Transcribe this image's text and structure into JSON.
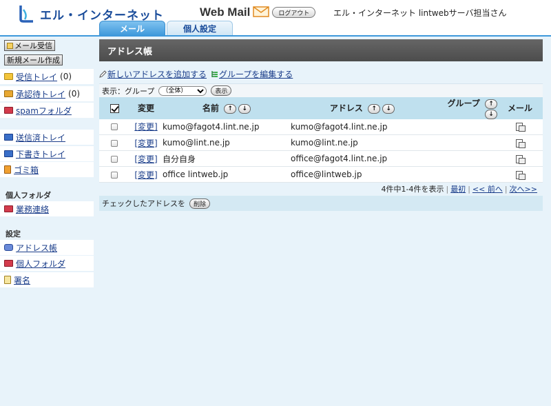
{
  "header": {
    "logo_text": "エル・インターネット",
    "app_title": "Web Mail",
    "logout_label": "ログアウト",
    "user_name": "エル・インターネット lintwebサーバ担当さん"
  },
  "tabs": [
    {
      "label": "メール",
      "active": true
    },
    {
      "label": "個人設定",
      "active": false
    }
  ],
  "sidebar": {
    "receive_button": "メール受信",
    "compose_button": "新規メール作成",
    "folders": [
      {
        "label": "受信トレイ",
        "count": "(0)",
        "icon": "folder-icon",
        "color": "#f3c43a"
      },
      {
        "label": "承認待トレイ",
        "count": "(0)",
        "icon": "folder-open-icon",
        "color": "#e8a832"
      },
      {
        "label": "spamフォルダ",
        "count": "",
        "icon": "spam-folder-icon",
        "color": "#d33b4c"
      }
    ],
    "system_folders": [
      {
        "label": "送信済トレイ",
        "icon": "folder-icon",
        "color": "#3a6fc8"
      },
      {
        "label": "下書きトレイ",
        "icon": "folder-icon",
        "color": "#3a6fc8"
      },
      {
        "label": "ゴミ箱",
        "icon": "trash-icon",
        "color": "#e08a20"
      }
    ],
    "personal_heading": "個人フォルダ",
    "personal_folders": [
      {
        "label": "業務連絡",
        "icon": "folder-icon",
        "color": "#d33b4c"
      }
    ],
    "settings_heading": "設定",
    "settings_items": [
      {
        "label": "アドレス帳",
        "icon": "address-book-icon"
      },
      {
        "label": "個人フォルダ",
        "icon": "personal-folder-icon"
      },
      {
        "label": "署名",
        "icon": "signature-icon"
      }
    ]
  },
  "main": {
    "title": "アドレス帳",
    "add_address_link": "新しいアドレスを追加する",
    "edit_group_link": "グループを編集する",
    "filter_label": "表示：グループ",
    "filter_selected": "（全体）",
    "filter_button": "表示",
    "columns": {
      "edit": "変更",
      "name": "名前",
      "address": "アドレス",
      "group": "グループ",
      "mail": "メール"
    },
    "sort_up": "↑",
    "sort_down": "↓",
    "edit_link": "[変更]",
    "rows": [
      {
        "name": "kumo@fagot4.lint.ne.jp",
        "address": "kumo@fagot4.lint.ne.jp",
        "group": ""
      },
      {
        "name": "kumo@lint.ne.jp",
        "address": "kumo@lint.ne.jp",
        "group": ""
      },
      {
        "name": "自分自身",
        "address": "office@fagot4.lint.ne.jp",
        "group": ""
      },
      {
        "name": "office lintweb.jp",
        "address": "office@lintweb.jp",
        "group": ""
      }
    ],
    "pager": {
      "summary": "4件中1-4件を表示",
      "first": "最初",
      "prev": "<< 前へ",
      "next": "次へ>>"
    },
    "bulk_label": "チェックしたアドレスを",
    "delete_button": "削除"
  },
  "colors": {
    "accent": "#3d98db",
    "title_bar": "#555555",
    "table_header": "#bfe0ee",
    "background": "#e8f3fa",
    "link": "#1a3d8a"
  }
}
